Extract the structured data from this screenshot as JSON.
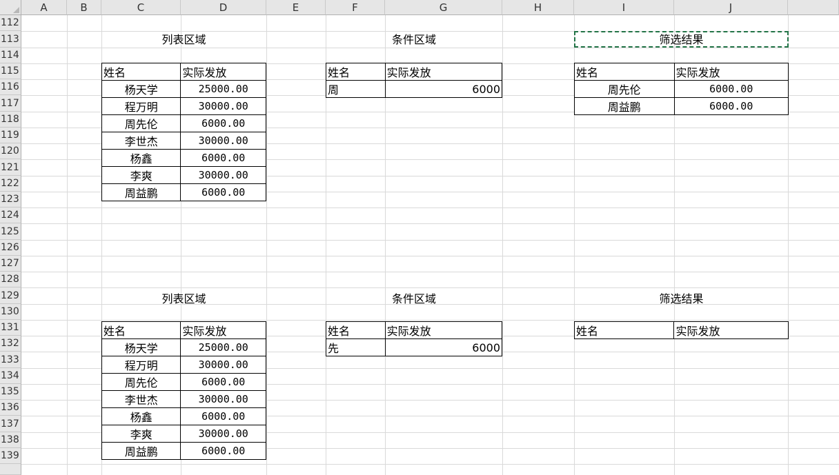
{
  "columns": [
    "A",
    "B",
    "C",
    "D",
    "E",
    "F",
    "G",
    "H",
    "I",
    "J"
  ],
  "rows": [
    "112",
    "113",
    "114",
    "115",
    "116",
    "117",
    "118",
    "119",
    "120",
    "121",
    "122",
    "123",
    "124",
    "125",
    "126",
    "127",
    "128",
    "129",
    "130",
    "131",
    "132",
    "133",
    "134",
    "135",
    "136",
    "137",
    "138",
    "139"
  ],
  "block1": {
    "list_title": "列表区域",
    "criteria_title": "条件区域",
    "result_title": "筛选结果",
    "list_header": [
      "姓名",
      "实际发放"
    ],
    "list_rows": [
      [
        "杨天学",
        "25000.00"
      ],
      [
        "程万明",
        "30000.00"
      ],
      [
        "周先伦",
        "6000.00"
      ],
      [
        "李世杰",
        "30000.00"
      ],
      [
        "杨鑫",
        "6000.00"
      ],
      [
        "李爽",
        "30000.00"
      ],
      [
        "周益鹏",
        "6000.00"
      ]
    ],
    "criteria_header": [
      "姓名",
      "实际发放"
    ],
    "criteria_row": [
      "周",
      "6000"
    ],
    "result_header": [
      "姓名",
      "实际发放"
    ],
    "result_rows": [
      [
        "周先伦",
        "6000.00"
      ],
      [
        "周益鹏",
        "6000.00"
      ]
    ]
  },
  "block2": {
    "list_title": "列表区域",
    "criteria_title": "条件区域",
    "result_title": "筛选结果",
    "list_header": [
      "姓名",
      "实际发放"
    ],
    "list_rows": [
      [
        "杨天学",
        "25000.00"
      ],
      [
        "程万明",
        "30000.00"
      ],
      [
        "周先伦",
        "6000.00"
      ],
      [
        "李世杰",
        "30000.00"
      ],
      [
        "杨鑫",
        "6000.00"
      ],
      [
        "李爽",
        "30000.00"
      ],
      [
        "周益鹏",
        "6000.00"
      ]
    ],
    "criteria_header": [
      "姓名",
      "实际发放"
    ],
    "criteria_row": [
      "先",
      "6000"
    ],
    "result_header": [
      "姓名",
      "实际发放"
    ]
  },
  "colors": {
    "selection": "#217346",
    "header_bg": "#e6e6e6",
    "grid": "#d9d9d9"
  }
}
